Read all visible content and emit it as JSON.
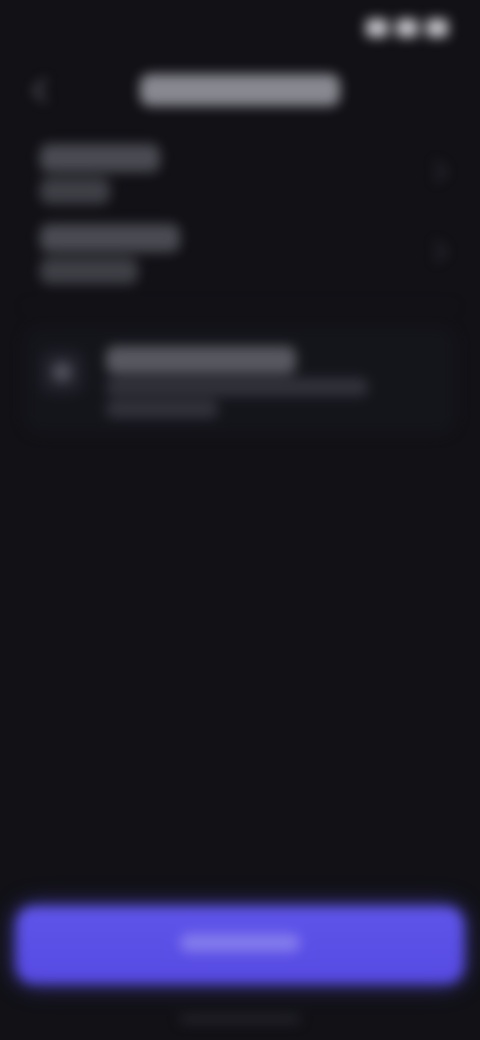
{
  "status_bar": {
    "time": "",
    "icons": [
      "signal-icon",
      "wifi-icon",
      "battery-icon"
    ]
  },
  "header": {
    "title": ""
  },
  "rows": [
    {
      "title": "",
      "subtitle": ""
    },
    {
      "title": "",
      "subtitle": ""
    }
  ],
  "card": {
    "title": "",
    "line_1": "",
    "line_2": ""
  },
  "cta": {
    "label": ""
  },
  "colors": {
    "background": "#111116",
    "accent": "#5f55ea",
    "text_primary": "#e8e8ec",
    "time_accent": "#c9b57a"
  }
}
